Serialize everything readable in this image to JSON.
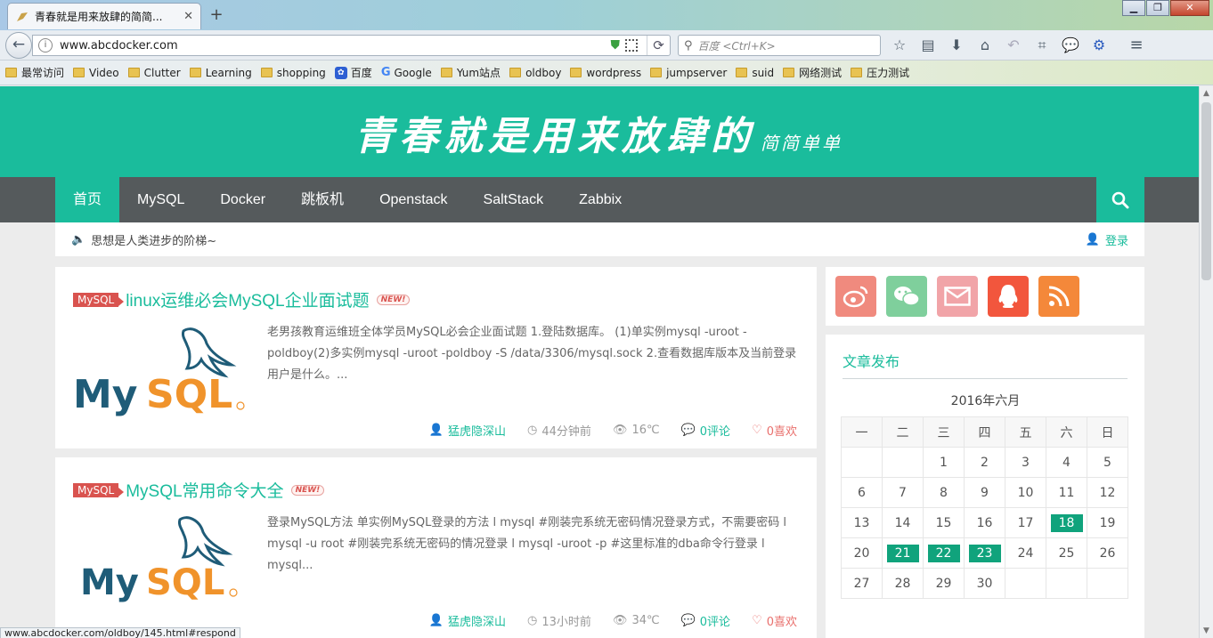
{
  "browser": {
    "tab_title": "青春就是用来放肆的简简...",
    "url": "www.abcdocker.com",
    "search_placeholder": "百度 <Ctrl+K>",
    "status_url": "www.abcdocker.com/oldboy/145.html#respond",
    "bookmarks": [
      {
        "label": "最常访问",
        "icon": "gear-folder-icon"
      },
      {
        "label": "Video",
        "icon": "folder-icon"
      },
      {
        "label": "Clutter",
        "icon": "folder-icon"
      },
      {
        "label": "Learning",
        "icon": "folder-icon"
      },
      {
        "label": "shopping",
        "icon": "folder-icon"
      },
      {
        "label": "百度",
        "icon": "baidu-icon"
      },
      {
        "label": "Google",
        "icon": "google-icon"
      },
      {
        "label": "Yum站点",
        "icon": "folder-icon"
      },
      {
        "label": "oldboy",
        "icon": "folder-icon"
      },
      {
        "label": "wordpress",
        "icon": "folder-icon"
      },
      {
        "label": "jumpserver",
        "icon": "folder-icon"
      },
      {
        "label": "suid",
        "icon": "folder-icon"
      },
      {
        "label": "网络测试",
        "icon": "folder-icon"
      },
      {
        "label": "压力测试",
        "icon": "folder-icon"
      }
    ]
  },
  "site": {
    "logo_main": "青春就是用来放肆的",
    "logo_sub": "简简单单",
    "nav": [
      "首页",
      "MySQL",
      "Docker",
      "跳板机",
      "Openstack",
      "SaltStack",
      "Zabbix"
    ],
    "notice": "思想是人类进步的阶梯~",
    "login_label": "登录"
  },
  "posts": [
    {
      "category": "MySQL",
      "title": "linux运维必会MySQL企业面试题",
      "new_tag": "NEW!",
      "excerpt": "老男孩教育运维班全体学员MySQL必会企业面试题 1.登陆数据库。 (1)单实例mysql -uroot -poldboy(2)多实例mysql -uroot -poldboy -S /data/3306/mysql.sock 2.查看数据库版本及当前登录用户是什么。...",
      "author": "猛虎隐深山",
      "time": "44分钟前",
      "views": "16℃",
      "comments": "0评论",
      "likes": "0喜欢"
    },
    {
      "category": "MySQL",
      "title": "MySQL常用命令大全",
      "new_tag": "NEW!",
      "excerpt": "登录MySQL方法 单实例MySQL登录的方法 l mysql #刚装完系统无密码情况登录方式，不需要密码 l mysql -u root #刚装完系统无密码的情况登录 l mysql -uroot -p #这里标准的dba命令行登录 l mysql...",
      "author": "猛虎隐深山",
      "time": "13小时前",
      "views": "34℃",
      "comments": "0评论",
      "likes": "0喜欢"
    }
  ],
  "sidebar": {
    "social": [
      {
        "name": "weibo-icon",
        "color": "#f08a7e"
      },
      {
        "name": "wechat-icon",
        "color": "#7fcf9c"
      },
      {
        "name": "mail-icon",
        "color": "#f1a4a8"
      },
      {
        "name": "qq-icon",
        "color": "#f2563d"
      },
      {
        "name": "rss-icon",
        "color": "#f4883a"
      }
    ],
    "calendar": {
      "heading": "文章发布",
      "caption": "2016年六月",
      "weekdays": [
        "一",
        "二",
        "三",
        "四",
        "五",
        "六",
        "日"
      ],
      "weeks": [
        [
          "",
          "",
          "1",
          "2",
          "3",
          "4",
          "5"
        ],
        [
          "6",
          "7",
          "8",
          "9",
          "10",
          "11",
          "12"
        ],
        [
          "13",
          "14",
          "15",
          "16",
          "17",
          "18",
          "19"
        ],
        [
          "20",
          "21",
          "22",
          "23",
          "24",
          "25",
          "26"
        ],
        [
          "27",
          "28",
          "29",
          "30",
          "",
          "",
          ""
        ]
      ],
      "highlighted": [
        "18",
        "21",
        "22",
        "23"
      ]
    }
  },
  "colors": {
    "accent": "#1abc9c",
    "nav_bg": "#555a5c",
    "badge": "#d9534f"
  }
}
